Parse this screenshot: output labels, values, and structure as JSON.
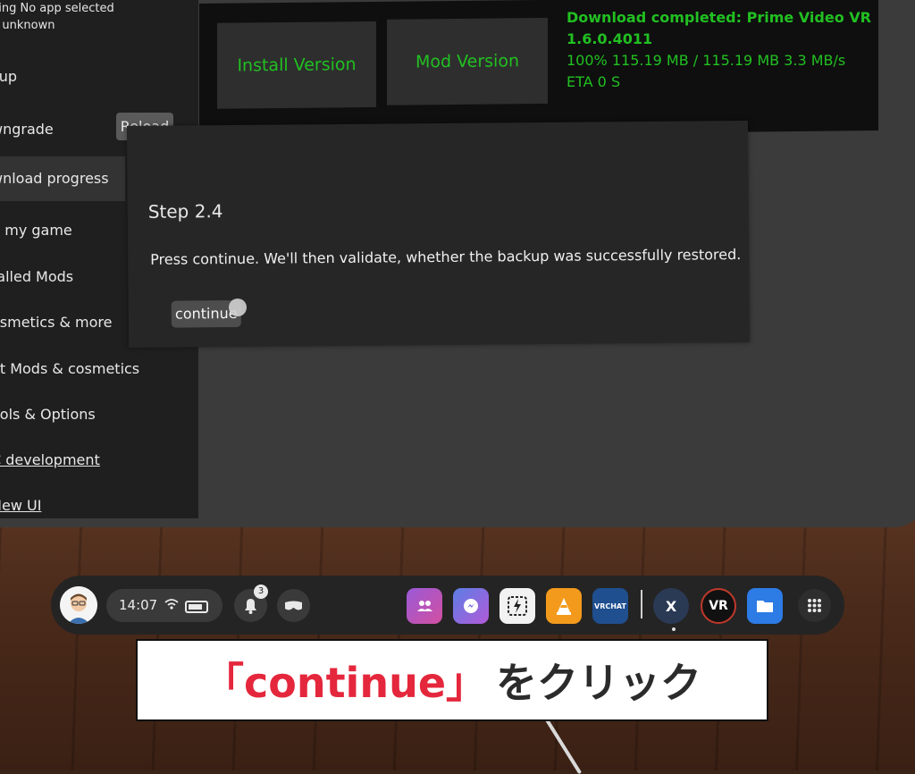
{
  "status": {
    "line1": "ging No app selected",
    "line2": "n unknown"
  },
  "sidebar": {
    "items": [
      {
        "label": "kup"
      },
      {
        "label": "wngrade"
      },
      {
        "label": "wnload progress"
      },
      {
        "label": "d my game"
      },
      {
        "label": "talled Mods"
      },
      {
        "label": "osmetics & more"
      },
      {
        "label": "et Mods & cosmetics"
      },
      {
        "label": "ools & Options"
      },
      {
        "label": "C development"
      },
      {
        "label": "New UI"
      }
    ],
    "reload_label": "Reload"
  },
  "top": {
    "install_label": "Install Version",
    "mod_label": "Mod Version",
    "download_title": "Download completed: Prime Video VR 1.6.0.4011",
    "download_progress": "100% 115.19 MB / 115.19 MB 3.3 MB/s",
    "download_eta": "ETA 0 S"
  },
  "dialog": {
    "title": "Step 2.4",
    "body": "Press continue. We'll then validate, whether the backup was successfully restored.",
    "continue_label": "continue"
  },
  "taskbar": {
    "time": "14:07",
    "notification_count": "3",
    "apps": [
      "people-icon",
      "messenger-icon",
      "media-icon",
      "vlc-icon",
      "vrchat-icon",
      "xamarin-icon",
      "vr-station-icon",
      "files-icon"
    ],
    "vrchat_label": "VRCHAT",
    "vr_label": "VR",
    "xamarin_label": "X"
  },
  "caption": {
    "highlight": "「continue」",
    "rest": "をクリック"
  },
  "colors": {
    "accent_green": "#21c021",
    "caption_red": "#e4273c"
  }
}
